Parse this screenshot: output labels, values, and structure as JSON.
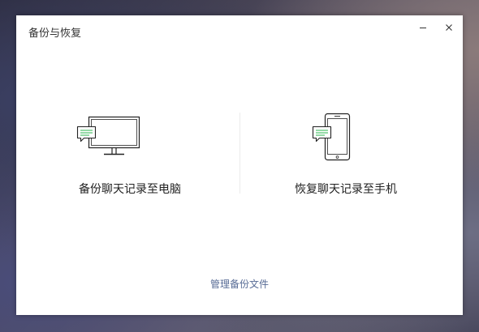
{
  "window": {
    "title": "备份与恢复",
    "minimize_icon": "minimize-icon",
    "close_icon": "close-icon"
  },
  "options": {
    "backup_to_pc": {
      "label": "备份聊天记录至电脑",
      "icon": "computer-with-chat-icon"
    },
    "restore_to_phone": {
      "label": "恢复聊天记录至手机",
      "icon": "phone-with-chat-icon"
    }
  },
  "footer": {
    "manage_link": "管理备份文件"
  },
  "colors": {
    "link": "#576b95",
    "icon_accent": "#3dbb5c",
    "icon_stroke": "#222222"
  }
}
